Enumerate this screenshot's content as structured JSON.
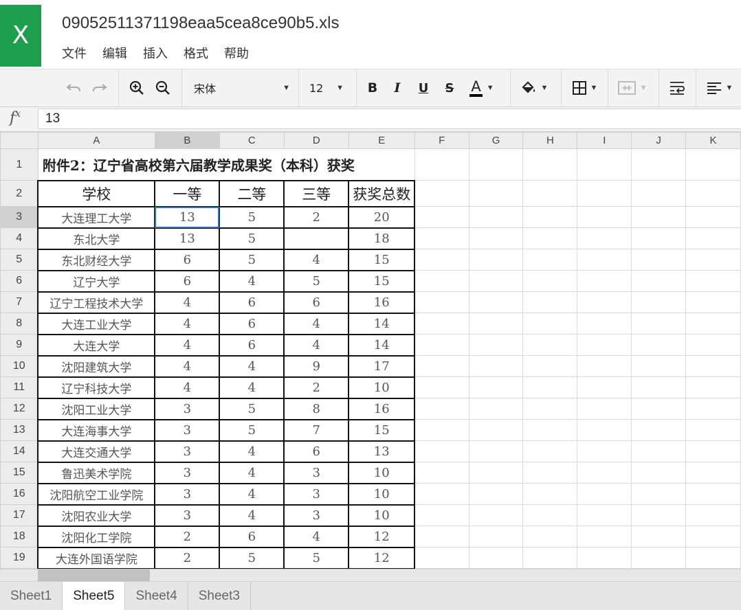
{
  "app": {
    "logo_letter": "X",
    "file_name": "09052511371198eaa5cea8ce90b5.xls"
  },
  "menu": [
    "文件",
    "编辑",
    "插入",
    "格式",
    "帮助"
  ],
  "toolbar": {
    "font_name": "宋体",
    "font_size": "12",
    "bold": "B",
    "italic": "I",
    "underline": "U",
    "strike": "S",
    "font_color": "A",
    "font_color_hex": "#000000",
    "icons": [
      "undo-icon",
      "redo-icon",
      "zoom-in-icon",
      "zoom-out-icon",
      "fill-color-icon",
      "borders-icon",
      "merge-cells-icon",
      "wrap-text-icon",
      "align-left-icon"
    ]
  },
  "formula_bar": {
    "fx": "f",
    "fx_sup": "x",
    "value": "13"
  },
  "columns": [
    "A",
    "B",
    "C",
    "D",
    "E",
    "F",
    "G",
    "H",
    "I",
    "J",
    "K"
  ],
  "selected_column": "B",
  "selected_row": "3",
  "sheet": {
    "title": "附件2：辽宁省高校第六届教学成果奖（本科）获奖",
    "headers": [
      "学校",
      "一等",
      "二等",
      "三等",
      "获奖总数"
    ],
    "rows": [
      [
        "大连理工大学",
        "13",
        "5",
        "2",
        "20"
      ],
      [
        "东北大学",
        "13",
        "5",
        "",
        "18"
      ],
      [
        "东北财经大学",
        "6",
        "5",
        "4",
        "15"
      ],
      [
        "辽宁大学",
        "6",
        "4",
        "5",
        "15"
      ],
      [
        "辽宁工程技术大学",
        "4",
        "6",
        "6",
        "16"
      ],
      [
        "大连工业大学",
        "4",
        "6",
        "4",
        "14"
      ],
      [
        "大连大学",
        "4",
        "6",
        "4",
        "14"
      ],
      [
        "沈阳建筑大学",
        "4",
        "4",
        "9",
        "17"
      ],
      [
        "辽宁科技大学",
        "4",
        "4",
        "2",
        "10"
      ],
      [
        "沈阳工业大学",
        "3",
        "5",
        "8",
        "16"
      ],
      [
        "大连海事大学",
        "3",
        "5",
        "7",
        "15"
      ],
      [
        "大连交通大学",
        "3",
        "4",
        "6",
        "13"
      ],
      [
        "鲁迅美术学院",
        "3",
        "4",
        "3",
        "10"
      ],
      [
        "沈阳航空工业学院",
        "3",
        "4",
        "3",
        "10"
      ],
      [
        "沈阳农业大学",
        "3",
        "4",
        "3",
        "10"
      ],
      [
        "沈阳化工学院",
        "2",
        "6",
        "4",
        "12"
      ],
      [
        "大连外国语学院",
        "2",
        "5",
        "5",
        "12"
      ]
    ]
  },
  "sheet_tabs": [
    "Sheet1",
    "Sheet5",
    "Sheet4",
    "Sheet3"
  ],
  "active_sheet": "Sheet5",
  "colors": {
    "logo_green": "#1e9e4f",
    "selection_blue": "#1a73e8"
  }
}
